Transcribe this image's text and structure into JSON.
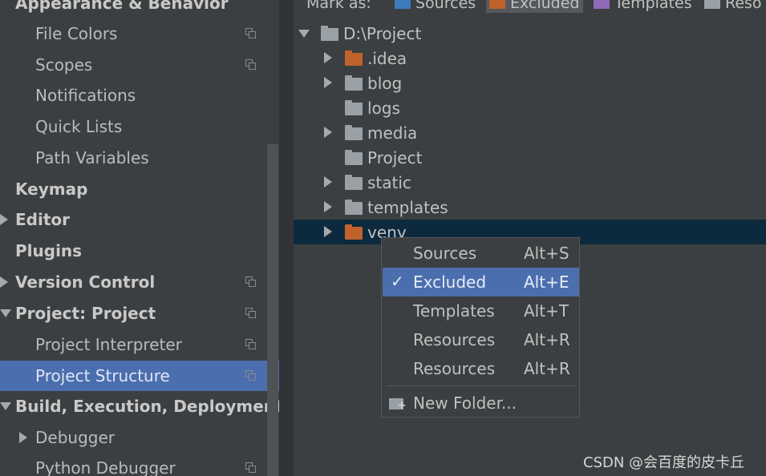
{
  "sidebar": {
    "items": [
      {
        "label": "Appearance & Behavior",
        "style": "bold",
        "arrow": "none",
        "copy_icon": false
      },
      {
        "label": "File Colors",
        "style": "normal",
        "arrow": "none",
        "copy_icon": true
      },
      {
        "label": "Scopes",
        "style": "normal",
        "arrow": "none",
        "copy_icon": true
      },
      {
        "label": "Notifications",
        "style": "normal",
        "arrow": "none",
        "copy_icon": false
      },
      {
        "label": "Quick Lists",
        "style": "normal",
        "arrow": "none",
        "copy_icon": false
      },
      {
        "label": "Path Variables",
        "style": "normal",
        "arrow": "none",
        "copy_icon": false
      },
      {
        "label": "Keymap",
        "style": "bold",
        "arrow": "none",
        "copy_icon": false
      },
      {
        "label": "Editor",
        "style": "bold",
        "arrow": "right",
        "copy_icon": false
      },
      {
        "label": "Plugins",
        "style": "bold",
        "arrow": "none",
        "copy_icon": false
      },
      {
        "label": "Version Control",
        "style": "bold",
        "arrow": "right",
        "copy_icon": true
      },
      {
        "label": "Project: Project",
        "style": "bold",
        "arrow": "down",
        "copy_icon": true
      },
      {
        "label": "Project Interpreter",
        "style": "normal",
        "arrow": "none",
        "copy_icon": true
      },
      {
        "label": "Project Structure",
        "style": "normal",
        "arrow": "none",
        "copy_icon": true,
        "selected": true
      },
      {
        "label": "Build, Execution, Deployment",
        "style": "bold",
        "arrow": "down",
        "copy_icon": false
      },
      {
        "label": "Debugger",
        "style": "normal",
        "arrow": "right",
        "copy_icon": false
      },
      {
        "label": "Python Debugger",
        "style": "normal",
        "arrow": "none",
        "copy_icon": true
      }
    ]
  },
  "markbar": {
    "label": "Mark as:",
    "items": [
      {
        "label": "Sources",
        "color": "#3d7bbd"
      },
      {
        "label": "Excluded",
        "color": "#c0622c",
        "pressed": true
      },
      {
        "label": "Templates",
        "color": "#8d6bb8"
      },
      {
        "label": "Reso",
        "color": "#9aa1a6"
      }
    ]
  },
  "tree": {
    "items": [
      {
        "label": "D:\\Project",
        "arrow": "down",
        "folder_color": "#9aa1a6"
      },
      {
        "label": ".idea",
        "arrow": "right",
        "folder_color": "#c0622c"
      },
      {
        "label": "blog",
        "arrow": "right",
        "folder_color": "#9aa1a6"
      },
      {
        "label": "logs",
        "arrow": "none",
        "folder_color": "#9aa1a6"
      },
      {
        "label": "media",
        "arrow": "right",
        "folder_color": "#9aa1a6"
      },
      {
        "label": "Project",
        "arrow": "none",
        "folder_color": "#9aa1a6"
      },
      {
        "label": "static",
        "arrow": "right",
        "folder_color": "#9aa1a6"
      },
      {
        "label": "templates",
        "arrow": "right",
        "folder_color": "#9aa1a6"
      },
      {
        "label": "venv",
        "arrow": "right",
        "folder_color": "#c0622c",
        "selected": true
      }
    ]
  },
  "popup": {
    "items": [
      {
        "label": "Sources",
        "shortcut": "Alt+S",
        "checked": false
      },
      {
        "label": "Excluded",
        "shortcut": "Alt+E",
        "checked": true,
        "selected": true
      },
      {
        "label": "Templates",
        "shortcut": "Alt+T",
        "checked": false
      },
      {
        "label": "Resources",
        "shortcut": "Alt+R",
        "checked": false
      },
      {
        "label": "Resources",
        "shortcut": "Alt+R",
        "checked": false
      }
    ],
    "new_folder_label": "New Folder..."
  },
  "watermark": "CSDN @会百度的皮卡丘"
}
